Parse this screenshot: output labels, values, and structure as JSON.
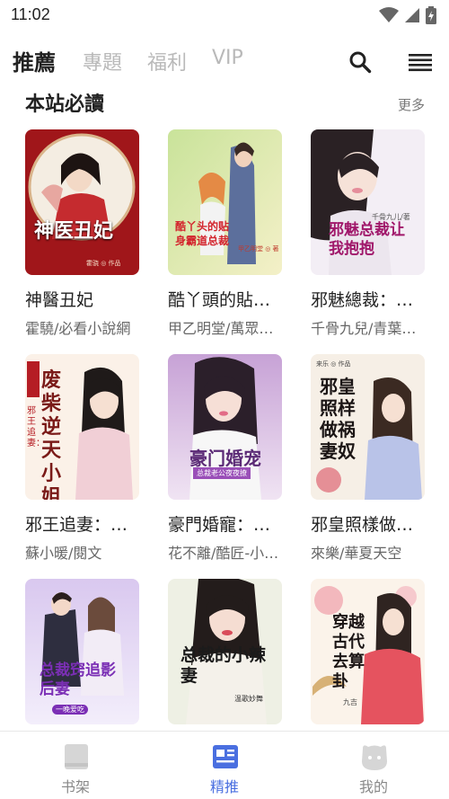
{
  "status_bar": {
    "time": "11:02"
  },
  "top_nav": {
    "tabs": [
      {
        "label": "推薦",
        "active": true
      },
      {
        "label": "專題",
        "active": false
      },
      {
        "label": "福利",
        "active": false
      },
      {
        "label": "VIP",
        "active": false
      }
    ]
  },
  "section": {
    "title": "本站必讀",
    "more": "更多"
  },
  "books": [
    {
      "title": "神醫丑妃",
      "author": "霍驍/必看小說網",
      "cover_text": "神医丑妃",
      "cover_sub": "霍骁 ◎ 作品"
    },
    {
      "title": "酷丫頭的貼…",
      "author": "甲乙明堂/萬眾…",
      "cover_text": "酷丫头的贴身霸道总裁",
      "cover_sub": "甲乙明堂 ◎ 著"
    },
    {
      "title": "邪魅總裁：…",
      "author": "千骨九兒/青葉…",
      "cover_text": "邪魅总裁让我抱抱",
      "cover_sub": "千骨九儿/著"
    },
    {
      "title": "邪王追妻：…",
      "author": "蘇小暖/閱文",
      "cover_text": "废柴逆天小姐",
      "cover_sub": "邪王追妻："
    },
    {
      "title": "豪門婚寵：…",
      "author": "花不離/酷匠-小…",
      "cover_text": "豪门婚宠",
      "cover_sub": "总裁老公夜夜撩"
    },
    {
      "title": "邪皇照樣做…",
      "author": "來樂/華夏天空",
      "cover_text": "邪皇照样做祸妻奴",
      "cover_sub": "来乐 ◎ 作品"
    },
    {
      "title": "",
      "author": "",
      "cover_text": "总裁窍追影后妻",
      "cover_sub": "一晚爱吃"
    },
    {
      "title": "",
      "author": "",
      "cover_text": "总裁的小辣妻",
      "cover_sub": "温歌妙舞"
    },
    {
      "title": "",
      "author": "",
      "cover_text": "穿越古代去算卦",
      "cover_sub": "九吉"
    }
  ],
  "bottom_nav": [
    {
      "label": "书架",
      "active": false,
      "icon": "bookshelf-icon"
    },
    {
      "label": "精推",
      "active": true,
      "icon": "featured-icon"
    },
    {
      "label": "我的",
      "active": false,
      "icon": "profile-icon"
    }
  ],
  "colors": {
    "accent": "#4a6fe0",
    "inactive_tab": "#b9b9b9",
    "text": "#222222"
  }
}
